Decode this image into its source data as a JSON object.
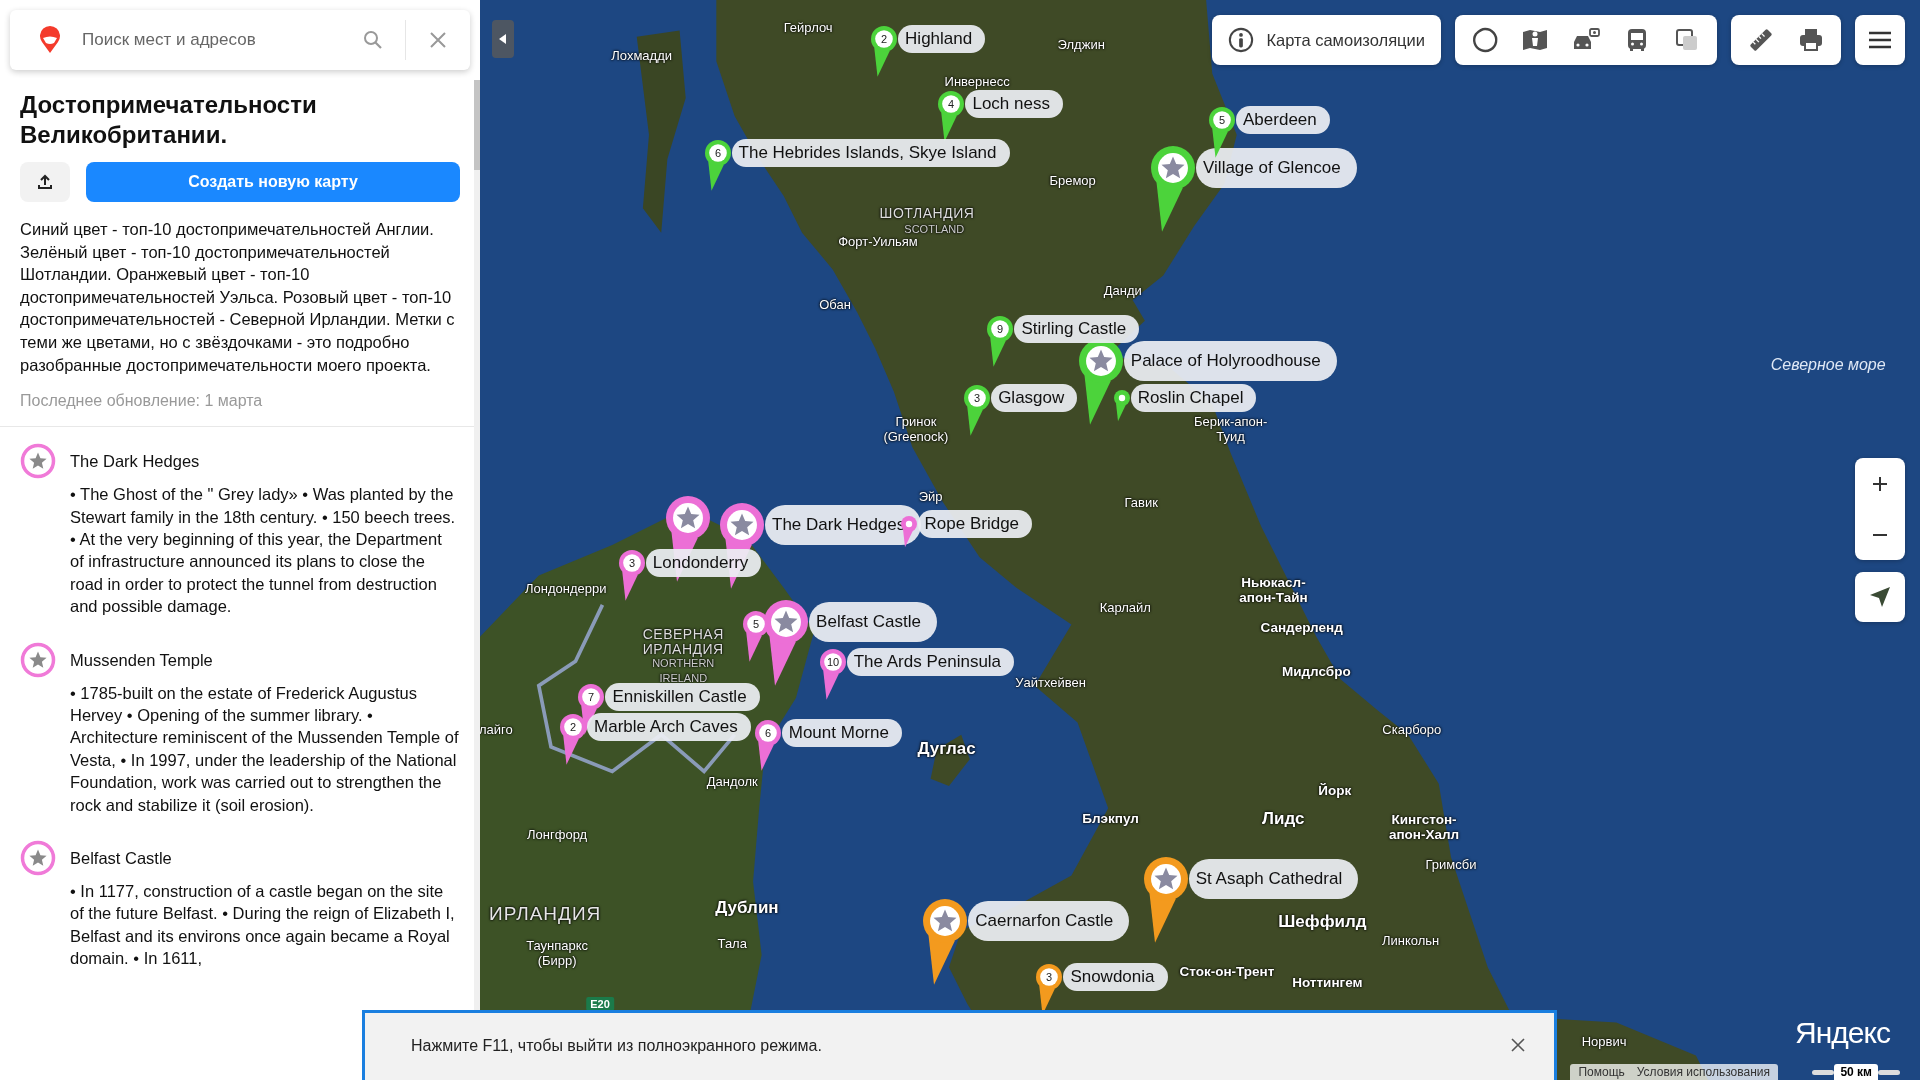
{
  "search": {
    "placeholder": "Поиск мест и адресов"
  },
  "map_info": {
    "title": "Достопримечательности Великобритании.",
    "create_button": "Создать новую карту",
    "description": "Синий цвет - топ-10 достопримечательностей Англии. Зелёный цвет - топ-10 достопримечательностей Шотландии. Оранжевый цвет - топ-10 достопримечательностей Уэльса. Розовый цвет - топ-10 достопримечательностей - Северной Ирландии. Метки с теми же цветами, но с звёздочками - это подробно разобранные достопримечательности моего проекта.",
    "updated": "Последнее обновление: 1 марта"
  },
  "places": [
    {
      "title": "The Dark Hedges",
      "description": "• The Ghost of the \" Grey lady» • Was planted by the Stewart family in the 18th century. • 150 beech trees. • At the very beginning of this year, the Department of infrastructure announced its plans to close the road in order to protect the tunnel from destruction and possible damage."
    },
    {
      "title": "Mussenden Temple",
      "description": "• 1785-built on the estate of Frederick Augustus Hervey • Opening of the summer library. • Architecture reminiscent of the Mussenden Temple of Vesta, • In 1997, under the leadership of the National Foundation, work was carried out to strengthen the rock and stabilize it (soil erosion)."
    },
    {
      "title": "Belfast Castle",
      "description": "• In 1177, construction of a castle began on the site of the future Belfast. • During the reign of Elizabeth I, Belfast and its environs once again became a Royal domain. • In 1611,"
    }
  ],
  "map": {
    "self_isolation_button": "Карта самоизоляции",
    "markers": [
      {
        "kind": "number",
        "number": "2",
        "label": "Highland",
        "color": "#4cd33b"
      },
      {
        "kind": "number",
        "number": "4",
        "label": "Loch ness",
        "color": "#4cd33b"
      },
      {
        "kind": "number",
        "number": "6",
        "label": "The Hebrides Islands, Skye Island",
        "color": "#4cd33b"
      },
      {
        "kind": "number",
        "number": "5",
        "label": "Aberdeen",
        "color": "#4cd33b"
      },
      {
        "kind": "star",
        "label": "Village of Glencoe",
        "color": "#4cd33b"
      },
      {
        "kind": "number",
        "number": "9",
        "label": "Stirling Castle",
        "color": "#4cd33b"
      },
      {
        "kind": "star",
        "label": "Palace of Holyroodhouse",
        "color": "#4cd33b"
      },
      {
        "kind": "dot",
        "label": "Roslin Chapel",
        "color": "#4cd33b"
      },
      {
        "kind": "number",
        "number": "3",
        "label": "Glasgow",
        "color": "#4cd33b"
      },
      {
        "kind": "star",
        "color": "#ec6fd6"
      },
      {
        "kind": "star",
        "label": "The Dark Hedges",
        "color": "#ec6fd6"
      },
      {
        "kind": "dot",
        "label": "Rope Bridge",
        "color": "#ec6fd6"
      },
      {
        "kind": "number",
        "number": "3",
        "label": "Londonderry",
        "color": "#ec6fd6"
      },
      {
        "kind": "number",
        "number": "5",
        "color": "#ec6fd6"
      },
      {
        "kind": "star",
        "label": "Belfast Castle",
        "color": "#ec6fd6"
      },
      {
        "kind": "number",
        "number": "10",
        "label": "The Ards Peninsula",
        "color": "#ec6fd6"
      },
      {
        "kind": "number",
        "number": "7",
        "label": "Enniskillen Castle",
        "color": "#ec6fd6"
      },
      {
        "kind": "number",
        "number": "2",
        "label": "Marble Arch Caves",
        "color": "#ec6fd6"
      },
      {
        "kind": "number",
        "number": "6",
        "label": "Mount Morne",
        "color": "#ec6fd6"
      },
      {
        "kind": "star",
        "label": "Caernarfon Castle",
        "color": "#f39a1e"
      },
      {
        "kind": "star",
        "label": "St Asaph Cathedral",
        "color": "#f39a1e"
      },
      {
        "kind": "number",
        "number": "3",
        "label": "Snowdonia",
        "color": "#f39a1e"
      }
    ],
    "labels": [
      {
        "kind": "town",
        "text": "Гейрлоч"
      },
      {
        "kind": "town",
        "text": "Лохмадди"
      },
      {
        "kind": "town",
        "text": "Элджин"
      },
      {
        "kind": "town",
        "text": "Инвернесс"
      },
      {
        "kind": "town",
        "text": "Бремор"
      },
      {
        "kind": "region",
        "text": "ШОТЛАНДИЯ"
      },
      {
        "kind": "region-sub",
        "text": "SCOTLAND"
      },
      {
        "kind": "town",
        "text": "Форт-Уильям"
      },
      {
        "kind": "town",
        "text": "Данди"
      },
      {
        "kind": "town",
        "text": "Обан"
      },
      {
        "kind": "town",
        "text": "Гринок (Greenock)"
      },
      {
        "kind": "town",
        "text": "Берик-апон-Туид"
      },
      {
        "kind": "sea",
        "text": "Северное море"
      },
      {
        "kind": "town",
        "text": "Эйр"
      },
      {
        "kind": "town",
        "text": "Гавик"
      },
      {
        "kind": "town",
        "text": "Лондондерри"
      },
      {
        "kind": "city",
        "text": "Ньюкасл-апон-Тайн"
      },
      {
        "kind": "town",
        "text": "Карлайл"
      },
      {
        "kind": "city",
        "text": "Сандерленд"
      },
      {
        "kind": "region",
        "text": "СЕВЕРНАЯ ИРЛАНДИЯ"
      },
      {
        "kind": "region-sub",
        "text": "NORTHERN IRELAND"
      },
      {
        "kind": "town",
        "text": "Уайтхейвен"
      },
      {
        "kind": "city",
        "text": "Мидлсбро"
      },
      {
        "kind": "town",
        "text": "лайго"
      },
      {
        "kind": "town",
        "text": "Скарборо"
      },
      {
        "kind": "capital",
        "text": "Дуглас"
      },
      {
        "kind": "town",
        "text": "Дандолк"
      },
      {
        "kind": "city",
        "text": "Йорк"
      },
      {
        "kind": "town",
        "text": "Лонгфорд"
      },
      {
        "kind": "city",
        "text": "Блэкпул"
      },
      {
        "kind": "capital",
        "text": "Лидс"
      },
      {
        "kind": "city",
        "text": "Кингстон-апон-Халл"
      },
      {
        "kind": "town",
        "text": "Гримсби"
      },
      {
        "kind": "country",
        "text": "ИРЛАНДИЯ"
      },
      {
        "kind": "capital",
        "text": "Дублин"
      },
      {
        "kind": "capital",
        "text": "Шеффилд"
      },
      {
        "kind": "town",
        "text": "Линкольн"
      },
      {
        "kind": "town",
        "text": "Таунпаркс (Бирр)"
      },
      {
        "kind": "town",
        "text": "Тала"
      },
      {
        "kind": "city",
        "text": "Сток-он-Трент"
      },
      {
        "kind": "city",
        "text": "Ноттингем"
      },
      {
        "kind": "town",
        "text": "Норвич"
      },
      {
        "kind": "road",
        "text": "E20"
      }
    ]
  },
  "notification": {
    "text": "Нажмите F11, чтобы выйти из полноэкранного режима."
  },
  "footer_links": [
    "Помощь",
    "Условия использования"
  ],
  "logo": "Яндекс",
  "scale": "50 км"
}
